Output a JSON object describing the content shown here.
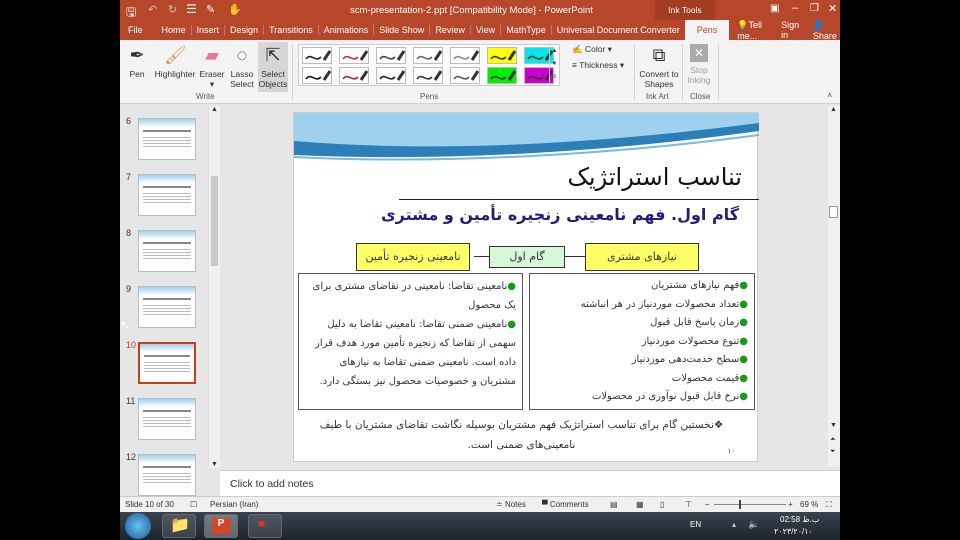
{
  "window": {
    "title": "scm-presentation-2.ppt [Compatibility Mode] - PowerPoint",
    "context_tab": "Ink Tools"
  },
  "tabs": [
    "File",
    "Home",
    "Insert",
    "Design",
    "Transitions",
    "Animations",
    "Slide Show",
    "Review",
    "View",
    "MathType",
    "Universal Document Converter",
    "Pens"
  ],
  "tell_me": "Tell me...",
  "sign_in": "Sign in",
  "share": "Share",
  "ribbon": {
    "pen": "Pen",
    "highlighter": "Highlighter",
    "eraser": "Eraser",
    "lasso": "Lasso Select",
    "select": "Select Objects",
    "write_group": "Write",
    "pens_group": "Pens",
    "color": "Color",
    "thickness": "Thickness",
    "convert": "Convert to Shapes",
    "ink_art_group": "Ink Art",
    "stop": "Stop Inking",
    "close_group": "Close"
  },
  "pens": [
    {
      "color": "#222222",
      "bg": "#ffffff"
    },
    {
      "color": "#c0304a",
      "bg": "#ffffff"
    },
    {
      "color": "#444444",
      "bg": "#ffffff"
    },
    {
      "color": "#666666",
      "bg": "#ffffff"
    },
    {
      "color": "#888888",
      "bg": "#ffffff"
    },
    {
      "color": "#333333",
      "bg": "#ffff00"
    },
    {
      "color": "#333333",
      "bg": "#00e5ee"
    },
    {
      "color": "#111111",
      "bg": "#ffffff"
    },
    {
      "color": "#b0203a",
      "bg": "#ffffff"
    },
    {
      "color": "#222222",
      "bg": "#ffffff"
    },
    {
      "color": "#333333",
      "bg": "#ffffff"
    },
    {
      "color": "#555555",
      "bg": "#ffffff"
    },
    {
      "color": "#333333",
      "bg": "#00ee00"
    },
    {
      "color": "#333333",
      "bg": "#cc00cc"
    }
  ],
  "thumbnails": [
    "6",
    "7",
    "8",
    "9",
    "10",
    "11",
    "12"
  ],
  "selected_slide": "10",
  "slide": {
    "title": "تناسب استراتژیک",
    "subtitle": "گام اول. فهم نامعینی زنجیره تأمین و مشتری",
    "box_right": "نیازهای مشتری",
    "box_mid": "گام اول",
    "box_left": "نامعینی زنجیره تأمین",
    "right_items": [
      "فهم نیازهای مشتریان",
      "تعداد محصولات موردنیاز در هر انباشته",
      "زمان پاسخ قابل قبول",
      "تنوع محصولات موردنیاز",
      "سطح خدمت‌دهی موردنیاز",
      "قیمت محصولات",
      "نرخ قابل قبول نوآوری در محصولات"
    ],
    "left_items": [
      "نامعینی تقاضا: نامعینی در تقاضای مشتری برای یک محصول",
      "نامعینی ضمنی تقاضا: نامعینی تقاضا به دلیل سهمی از تقاضا که زنجیره تأمین مورد هدف قرار داده است. نامعینی ضمنی تقاضا به نیازهای مشتریان و خصوصیات محصول نیز بستگی دارد."
    ],
    "footer": "نخستین گام برای تناسب استراتژیک فهم مشتریان بوسیله نگاشت تقاضای مشتریان با طیف نامعینی‌های ضمنی است.",
    "page_no": "۱۰"
  },
  "notes_placeholder": "Click to add notes",
  "status": {
    "slide": "Slide 10 of 30",
    "language": "Persian (Iran)",
    "notes": "Notes",
    "comments": "Comments",
    "zoom": "69 %",
    "zoom_percent": 69
  },
  "taskbar": {
    "lang": "EN",
    "time": "02:58 ب.ظ",
    "date": "۲۰۲۳/۲۰/۱۰"
  }
}
